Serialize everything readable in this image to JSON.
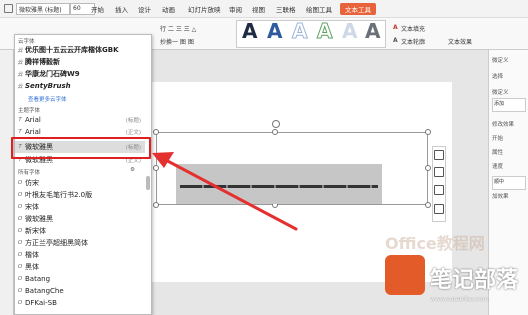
{
  "menubar": {
    "font_value": "微软雅黑 (标题)",
    "size_value": "60",
    "tabs": [
      "开始",
      "插入",
      "设计",
      "动画",
      "幻灯片放映",
      "审阅",
      "视图",
      "三联格",
      "绘图工具",
      "文本工具"
    ],
    "active_tab": "文本工具"
  },
  "ribbon": {
    "row1_left": "行 二 三 三 △",
    "row2_left": "抄换一 图 图",
    "style_letters": [
      "A",
      "A",
      "A",
      "A",
      "A",
      "A"
    ],
    "text_fill": "文本填充",
    "text_outline": "文本轮廓",
    "text_effect": "文本效果"
  },
  "dropdown": {
    "cloud_section": "云字体",
    "cloud_fonts": [
      "优乐图十五云云开库楷体GBK",
      "腾祥博毅新",
      "华康龙门石碑W9",
      "SentyBrush"
    ],
    "more_cloud": "查看更多云字体",
    "theme_section": "主题字体",
    "theme_fonts": [
      {
        "name": "Arial",
        "tag": "(标题)"
      },
      {
        "name": "Arial",
        "tag": "(正文)"
      },
      {
        "name": "微软雅黑",
        "tag": "(标题)"
      },
      {
        "name": "微软雅黑",
        "tag": "(正文)"
      }
    ],
    "all_section": "所有字体",
    "all_fonts": [
      "仿宋",
      "叶根友毛笔行书2.0版",
      "宋体",
      "微软雅黑",
      "新宋体",
      "方正兰亭超细黑简体",
      "楷体",
      "黑体",
      "Batang",
      "BatangChe",
      "DFKai-SB"
    ]
  },
  "right_panel": {
    "title": "微定义",
    "items": [
      "选择",
      "微定义",
      "添加",
      "修改效果",
      "开始",
      "属性",
      "速度",
      "顺中",
      "加效果"
    ]
  },
  "watermark": {
    "brand": "笔记部落",
    "url": "www.notetribe.com",
    "ghost": "Office教程网"
  },
  "colors": {
    "accent": "#e8633b",
    "highlight": "#e02020",
    "arrow": "#e53030"
  }
}
